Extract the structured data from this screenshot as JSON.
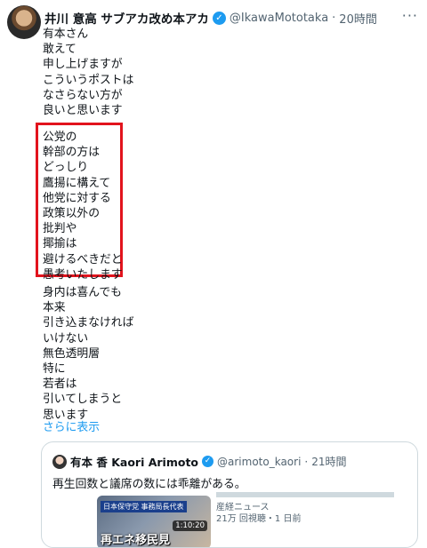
{
  "tweet": {
    "author_name": "井川 意高 サブアカ改め本アカ",
    "handle": "@IkawaMototaka",
    "separator": "·",
    "time": "20時間",
    "more_icon": "more-dots-icon",
    "verified_icon": "verified-badge-icon",
    "block1": [
      "有本さん",
      "敢えて",
      "申し上げますが",
      "こういうポストは",
      "なさらない方が",
      "良いと思います"
    ],
    "block2": [
      "公党の",
      "幹部の方は",
      "どっしり",
      "鷹揚に構えて",
      "他党に対する",
      "政策以外の",
      "批判や",
      "揶揄は",
      "避けるべきだと",
      "愚考いたします"
    ],
    "block3": [
      "身内は喜んでも",
      "本来",
      "引き込まなければ",
      "いけない",
      "無色透明層",
      "特に",
      "若者は",
      "引いてしまうと",
      "思います"
    ],
    "show_more": "さらに表示",
    "highlight_color": "#e2131d"
  },
  "quoted": {
    "author_name": "有本 香 Kaori Arimoto",
    "handle": "@arimoto_kaori",
    "separator": "·",
    "time": "21時間",
    "text": "再生回数と議席の数には乖離がある。",
    "thumbnail": {
      "tag": "日本保守党 事務局長代表",
      "caption": "再エネ移民見",
      "duration": "1:10:20",
      "source": "産経ニュース",
      "meta": "21万 回視聴・1 日前"
    }
  }
}
